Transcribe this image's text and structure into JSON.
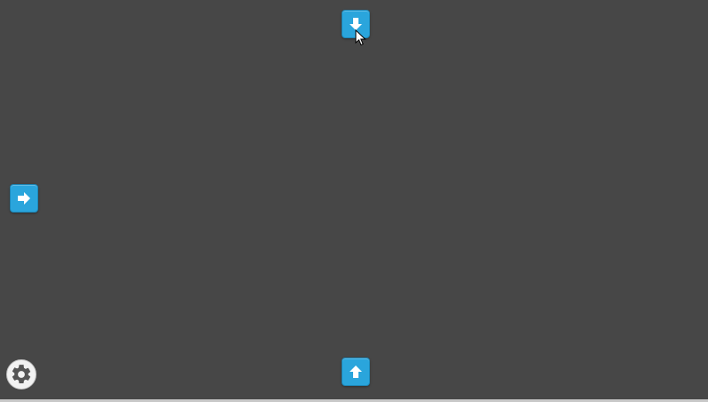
{
  "navigation": {
    "buttons": [
      {
        "id": "down",
        "icon": "arrow-down-icon"
      },
      {
        "id": "right",
        "icon": "arrow-right-icon"
      },
      {
        "id": "up",
        "icon": "arrow-up-icon"
      }
    ]
  },
  "settings": {
    "icon": "gear-icon"
  },
  "colors": {
    "background": "#474747",
    "accent": "#2aa5dc",
    "icon_fill": "#ffffff",
    "settings_bg": "#f2f2f2",
    "gear": "#555555"
  }
}
